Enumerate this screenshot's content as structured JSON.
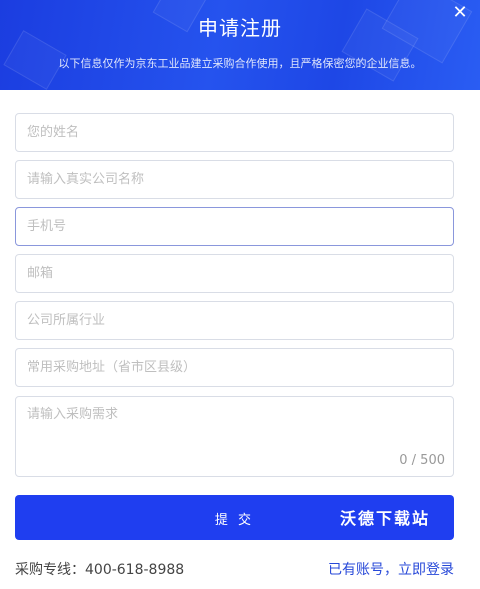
{
  "header": {
    "title": "申请注册",
    "subtitle": "以下信息仅作为京东工业品建立采购合作使用，且严格保密您的企业信息。",
    "close_icon": "close-icon",
    "close_glyph": "✕"
  },
  "form": {
    "fields": [
      {
        "placeholder": "您的姓名"
      },
      {
        "placeholder": "请输入真实公司名称"
      },
      {
        "placeholder": "手机号"
      },
      {
        "placeholder": "邮箱"
      },
      {
        "placeholder": "公司所属行业"
      },
      {
        "placeholder": "常用采购地址（省市区县级）"
      }
    ],
    "requirement": {
      "placeholder": "请输入采购需求",
      "counter": "0 / 500"
    },
    "submit_label": "提 交",
    "watermark": "沃德下载站"
  },
  "footer": {
    "hotline": "采购专线：400-618-8988",
    "login_link": "已有账号，立即登录"
  },
  "colors": {
    "brand": "#1f3ef0",
    "link": "#2748d8"
  }
}
